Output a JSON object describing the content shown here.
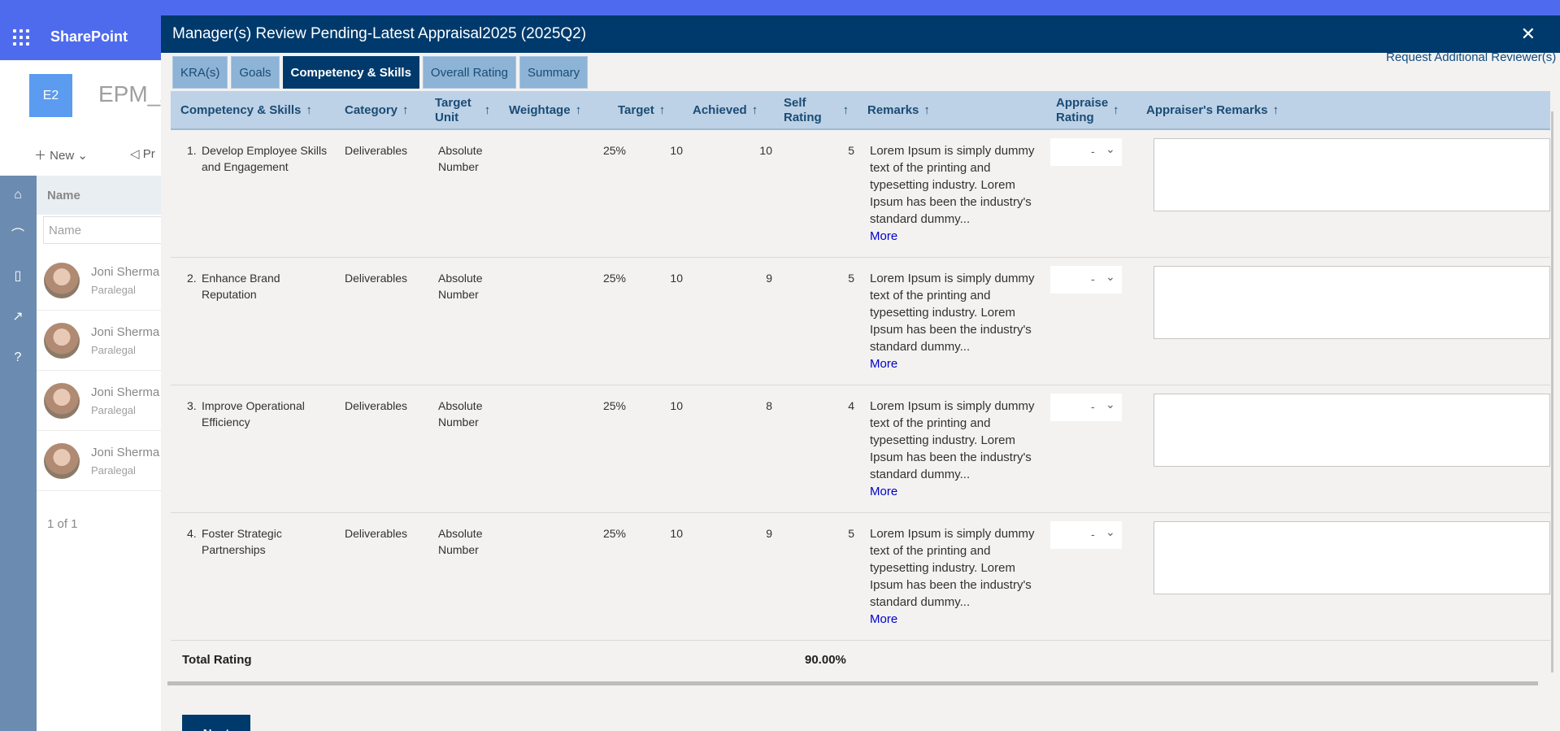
{
  "sharepoint": {
    "brand": "SharePoint",
    "site_tile": "E2",
    "site_title": "EPM_A",
    "cmd_new": "New",
    "cmd_pr": "Pr",
    "list": {
      "header": "Name",
      "filter_placeholder": "Name",
      "people": [
        {
          "name": "Joni Sherma",
          "role": "Paralegal"
        },
        {
          "name": "Joni Sherma",
          "role": "Paralegal"
        },
        {
          "name": "Joni Sherma",
          "role": "Paralegal"
        },
        {
          "name": "Joni Sherma",
          "role": "Paralegal"
        }
      ],
      "pager": "1 of 1"
    }
  },
  "dialog": {
    "title": "Manager(s) Review Pending-Latest Appraisal2025 (2025Q2)",
    "close": "✕",
    "request_link": "Request Additional Reviewer(s)",
    "tabs": [
      {
        "label": "KRA(s)"
      },
      {
        "label": "Goals"
      },
      {
        "label": "Competency & Skills"
      },
      {
        "label": "Overall Rating"
      },
      {
        "label": "Summary"
      }
    ],
    "columns": {
      "competency": "Competency & Skills",
      "category": "Category",
      "target_unit_1": "Target",
      "target_unit_2": "Unit",
      "weightage": "Weightage",
      "target": "Target",
      "achieved": "Achieved",
      "self_rating_1": "Self",
      "self_rating_2": "Rating",
      "remarks": "Remarks",
      "appraiser_rating_1": "Appraiser",
      "appraiser_rating_2": "Rating",
      "appraiser_remarks": "Appraiser's Remarks",
      "sort_icon": "↑"
    },
    "rows": [
      {
        "index": "1.",
        "name": "Develop Employee Skills and Engagement",
        "category": "Deliverables",
        "unit": "Absolute Number",
        "weightage": "25%",
        "target": "10",
        "achieved": "10",
        "self_rating": "5",
        "remarks": "Lorem Ipsum is simply dummy text of the printing and typesetting industry. Lorem Ipsum has been the industry's standard dummy...",
        "more": "More",
        "rating": "-"
      },
      {
        "index": "2.",
        "name": "Enhance Brand Reputation",
        "category": "Deliverables",
        "unit": "Absolute Number",
        "weightage": "25%",
        "target": "10",
        "achieved": "9",
        "self_rating": "5",
        "remarks": "Lorem Ipsum is simply dummy text of the printing and typesetting industry. Lorem Ipsum has been the industry's standard dummy...",
        "more": "More",
        "rating": "-"
      },
      {
        "index": "3.",
        "name": "Improve Operational Efficiency",
        "category": "Deliverables",
        "unit": "Absolute Number",
        "weightage": "25%",
        "target": "10",
        "achieved": "8",
        "self_rating": "4",
        "remarks": "Lorem Ipsum is simply dummy text of the printing and typesetting industry. Lorem Ipsum has been the industry's standard dummy...",
        "more": "More",
        "rating": "-"
      },
      {
        "index": "4.",
        "name": "Foster Strategic Partnerships",
        "category": "Deliverables",
        "unit": "Absolute Number",
        "weightage": "25%",
        "target": "10",
        "achieved": "9",
        "self_rating": "5",
        "remarks": "Lorem Ipsum is simply dummy text of the printing and typesetting industry. Lorem Ipsum has been the industry's standard dummy...",
        "more": "More",
        "rating": "-"
      }
    ],
    "total_label": "Total Rating",
    "total_value": "90.00%",
    "next_label": "Next"
  }
}
